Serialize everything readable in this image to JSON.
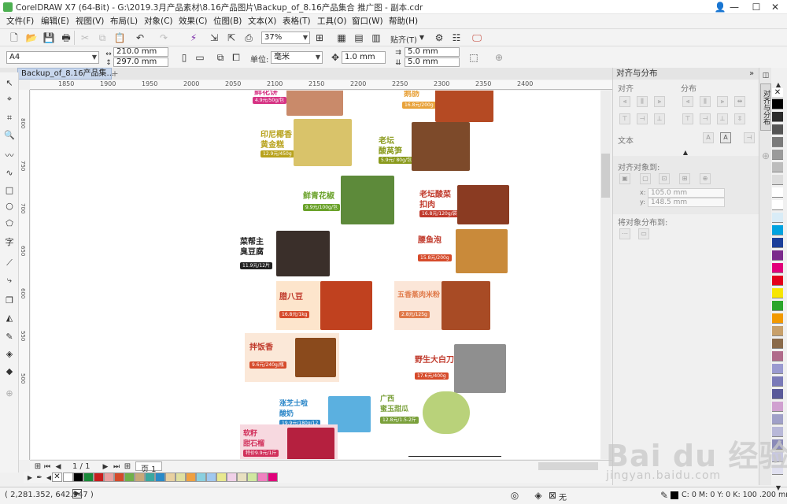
{
  "window": {
    "title": "CorelDRAW X7 (64-Bit) - G:\\2019.3月产品素材\\8.16产品图片\\Backup_of_8.16产品集合 推广图 - 副本.cdr",
    "minimize": "—",
    "maximize": "☐",
    "close": "✕"
  },
  "menu": [
    "文件(F)",
    "编辑(E)",
    "视图(V)",
    "布局(L)",
    "对象(C)",
    "效果(C)",
    "位图(B)",
    "文本(X)",
    "表格(T)",
    "工具(O)",
    "窗口(W)",
    "帮助(H)"
  ],
  "toolbar": {
    "zoom": "37%",
    "snap_label": "贴齐(T)"
  },
  "propertybar": {
    "paper": "A4",
    "width": "210.0 mm",
    "height": "297.0 mm",
    "units_label": "单位:",
    "units": "毫米",
    "nudge": "1.0 mm",
    "dup_x": "5.0 mm",
    "dup_y": "5.0 mm"
  },
  "document_tab": "Backup_of_8.16产品集...",
  "ruler": {
    "h_ticks": [
      "1850",
      "1900",
      "1950",
      "2000",
      "2050",
      "2100",
      "2150",
      "2200",
      "2250",
      "2300",
      "2350",
      "2400"
    ],
    "v_ticks": [
      "800",
      "750",
      "700",
      "650",
      "600",
      "550",
      "500"
    ]
  },
  "products": [
    {
      "title": "鲜花饼",
      "price": "4.9元/50g/包",
      "title_color": "#d63384",
      "price_color": "#d63384",
      "img_color": "#c98a6a"
    },
    {
      "title": "鹅肠",
      "price": "16.8元/200g",
      "title_color": "#e8a23a",
      "price_color": "#e8a23a",
      "img_color": "#b54a23"
    },
    {
      "title": "印尼椰香\n黄金糕",
      "price": "12.9元/450g",
      "title_color": "#b8a21c",
      "price_color": "#b8a21c",
      "img_color": "#d9c36a"
    },
    {
      "title": "老坛\n酸莴笋",
      "price": "5.9元/ 80g/包",
      "title_color": "#8a9a1c",
      "price_color": "#8a9a1c",
      "img_color": "#7d4a2a"
    },
    {
      "title": "鲜青花椒",
      "price": "9.9元/100g/包",
      "title_color": "#6aa22a",
      "price_color": "#6aa22a",
      "img_color": "#5d8a3a"
    },
    {
      "title": "老坛酸菜\n扣肉",
      "price": "16.8元/120g/袋",
      "title_color": "#c0392b",
      "price_color": "#c0392b",
      "img_color": "#8a3b22"
    },
    {
      "title": "菜帮主\n臭豆腐",
      "price": "11.9元/12片",
      "title_color": "#222222",
      "price_color": "#222222",
      "img_color": "#3a2f2a"
    },
    {
      "title": "腰鱼泡",
      "price": "15.8元/200g",
      "title_color": "#c0392b",
      "price_color": "#d64b2b",
      "img_color": "#c98a3a"
    },
    {
      "title": "腊八豆",
      "price": "16.8元/1kg",
      "title_color": "#c0392b",
      "price_color": "#d64b2b",
      "img_color": "#c0411f"
    },
    {
      "title": "五香蒸肉米粉",
      "price": "2.8元/125g",
      "title_color": "#e07a4a",
      "price_color": "#e07a4a",
      "img_color": "#a84b25"
    },
    {
      "title": "拌饭香",
      "price": "9.6元/240g/瓶",
      "title_color": "#c0392b",
      "price_color": "#d64b2b",
      "img_color": "#8a4a1c"
    },
    {
      "title": "野生大白刀",
      "price": "17.6元/400g",
      "title_color": "#c0392b",
      "price_color": "#d64b2b",
      "img_color": "#8f8f8f"
    },
    {
      "title": "涨芝士啦\n酸奶",
      "price": "19.9元/180g/12",
      "title_color": "#2a86c8",
      "price_color": "#2a86c8",
      "img_color": "#5bb0e0"
    },
    {
      "title": "广西\n蜜玉甜瓜",
      "price": "12.8元/1.5-2斤",
      "title_color": "#7aa03a",
      "price_color": "#7aa03a",
      "img_color": "#b9d27a"
    },
    {
      "title": "软籽\n甜石榴",
      "price": "特价9.9元/1斤",
      "title_color": "#d12f5a",
      "price_color": "#d12f5a",
      "img_color": "#b5203f"
    }
  ],
  "pagebar": {
    "page_count": "1 / 1",
    "page_tab": "页 1"
  },
  "palette_row": [
    "#ffffff",
    "#000000",
    "#1a8a3a",
    "#c81e1e",
    "#e8a0a0",
    "#d44a2a",
    "#6fb04a",
    "#c8a87a",
    "#3aa8a0",
    "#2a8ac8",
    "#e8d0a0",
    "#e0e0a0",
    "#f0a040",
    "#8ad0e0",
    "#a0c8f0",
    "#e8e890",
    "#f0d0e8",
    "#e8e0c0",
    "#d0e8a0",
    "#f080c0",
    "#e0007a"
  ],
  "status": {
    "coords": "( 2,281.352, 642.947 )",
    "fill_none": "无",
    "outline": "C: 0 M: 0 Y: 0 K: 100  .200 mm"
  },
  "docker": {
    "title": "对齐与分布",
    "align": "对齐",
    "distribute": "分布",
    "text": "文本",
    "align_to": "对齐对象到:",
    "x": "105.0 mm",
    "y": "148.5 mm",
    "distribute_to": "将对象分布到:",
    "side_tab": "对齐与分布"
  },
  "right_palette": [
    "#000000",
    "#2b2b2b",
    "#555555",
    "#7a7a7a",
    "#9a9a9a",
    "#bdbdbd",
    "#dcdcdc",
    "#ffffff",
    "#ffffff",
    "#d9ecf7",
    "#00a3e0",
    "#1b3f9a",
    "#7b2a8c",
    "#e2007a",
    "#e4001b",
    "#f7e600",
    "#2aa52a",
    "#f29900",
    "#c8a06a",
    "#8a6a4a",
    "#b06a8a",
    "#9a9ad0",
    "#7a7ab8",
    "#5a5a9a",
    "#d0a0d0",
    "#a0a0c8",
    "#b8b8d8",
    "#8a8ab8",
    "#c8c8e0",
    "#e0e0f0"
  ],
  "watermark": {
    "brand": "Bai du 经验",
    "url": "jingyan.baidu.com"
  }
}
